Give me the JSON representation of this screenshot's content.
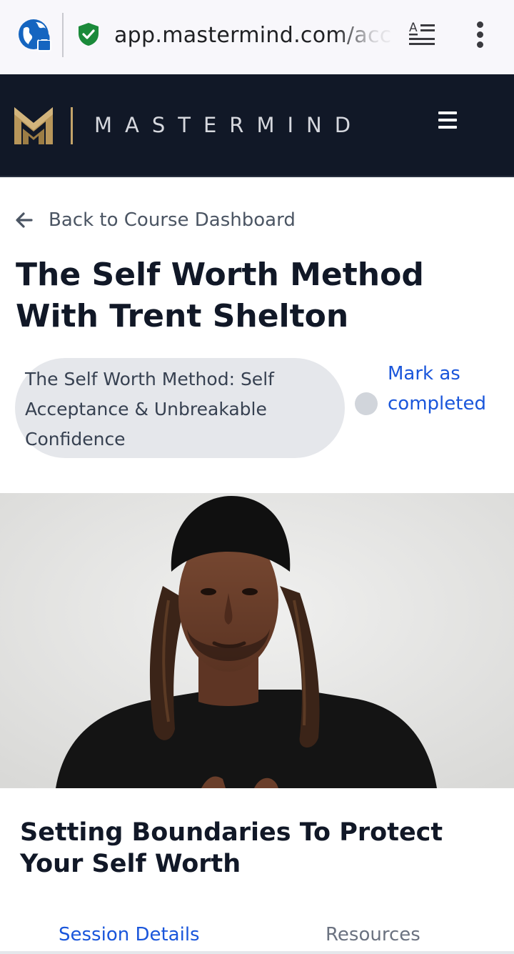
{
  "browser": {
    "url_visible": "app.mastermind.com/acc",
    "icons": {
      "site_info": "globe-lock-icon",
      "security": "shield-check-icon",
      "reader": "reader-mode-icon",
      "menu": "kebab-menu-icon"
    },
    "security_color": "#1b8a3a"
  },
  "header": {
    "brand_name": "MASTERMIND",
    "brand_logo": "mastermind-m-logo",
    "background_color": "#111827",
    "accent_color": "#c4a46a",
    "menu_icon": "hamburger-icon"
  },
  "nav": {
    "back_label": "Back to Course Dashboard",
    "back_icon": "arrow-left-icon"
  },
  "course": {
    "title": "The Self Worth Method With Trent Shelton",
    "module_label": "The Self Worth Method: Self Acceptance & Unbreakable Confidence",
    "mark_completed_label": "Mark as completed",
    "completed": false
  },
  "video": {
    "thumbnail": "instructor-video-thumbnail"
  },
  "session": {
    "title": "Setting Boundaries To Protect Your Self Worth"
  },
  "tabs": [
    {
      "label": "Session Details",
      "active": true
    },
    {
      "label": "Resources",
      "active": false
    }
  ],
  "colors": {
    "link_blue": "#1a56db",
    "muted_text": "#6b7280",
    "pill_bg": "#e5e7eb"
  }
}
